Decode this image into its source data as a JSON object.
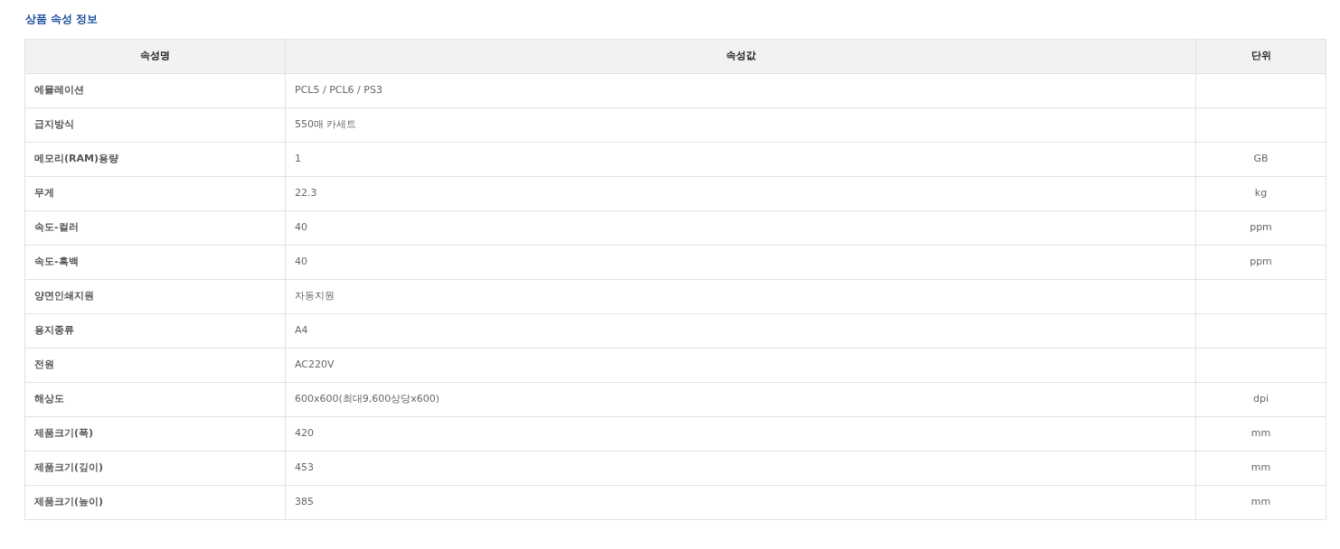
{
  "title": "상품 속성 정보",
  "table": {
    "columns": [
      "속성명",
      "속성값",
      "단위"
    ],
    "rows": [
      {
        "name": "에뮬레이션",
        "value": "PCL5 / PCL6 / PS3"
      },
      {
        "name": "급지방식",
        "value": "550매 카세트"
      },
      {
        "name": "메모리(RAM)용량",
        "value": "1",
        "unit": "GB"
      },
      {
        "name": "무게",
        "value": "22.3",
        "unit": "kg"
      },
      {
        "name": "속도-컬러",
        "value": "40",
        "unit": "ppm"
      },
      {
        "name": "속도-흑백",
        "value": "40",
        "unit": "ppm"
      },
      {
        "name": "양면인쇄지원",
        "value": "자동지원"
      },
      {
        "name": "용지종류",
        "value": "A4"
      },
      {
        "name": "전원",
        "value": "AC220V"
      },
      {
        "name": "해상도",
        "value": "600x600(최대9,600상당x600)",
        "unit": "dpi"
      },
      {
        "name": "제품크기(폭)",
        "value": "420",
        "unit": "mm"
      },
      {
        "name": "제품크기(깊이)",
        "value": "453",
        "unit": "mm"
      },
      {
        "name": "제품크기(높이)",
        "value": "385",
        "unit": "mm"
      }
    ]
  }
}
